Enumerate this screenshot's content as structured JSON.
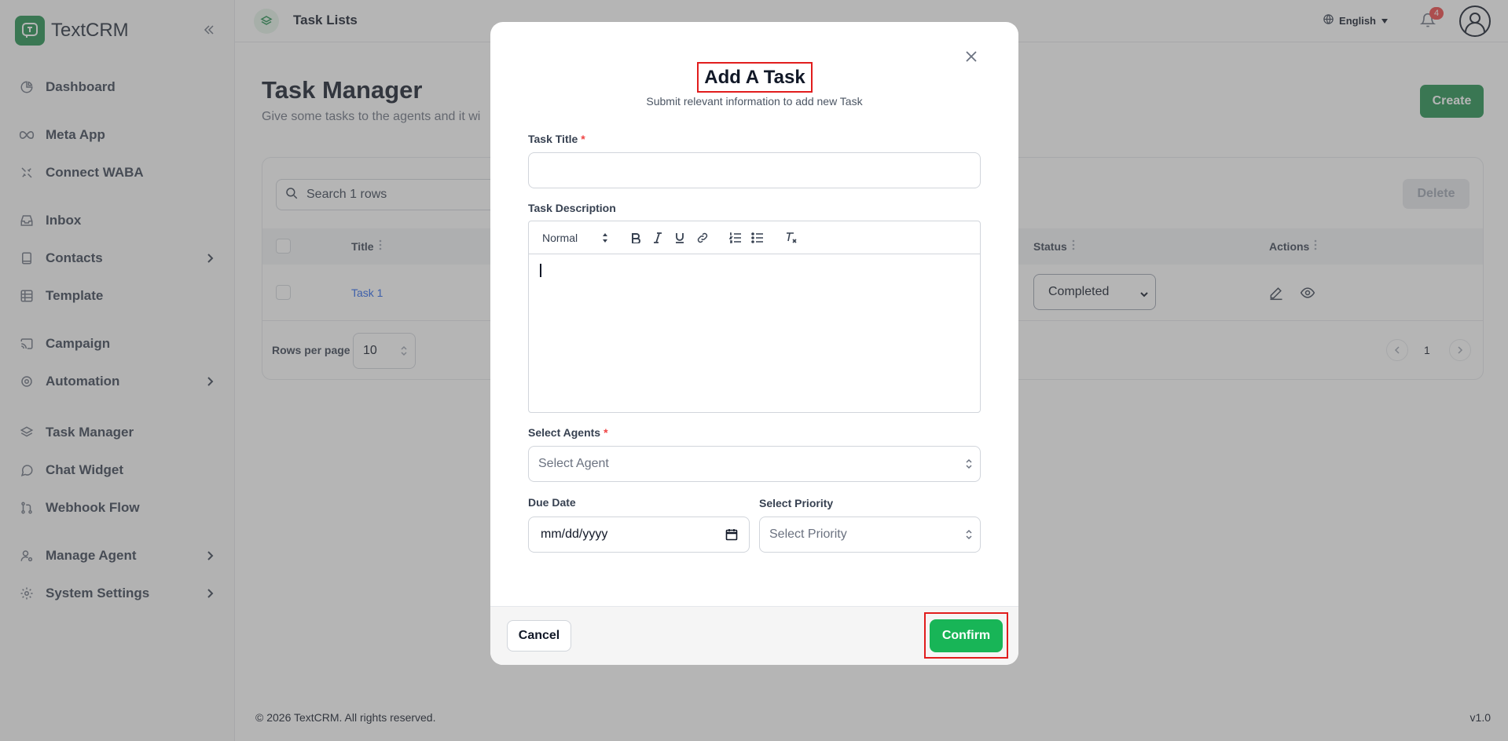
{
  "app": {
    "name": "TextCRM"
  },
  "sidebar": {
    "items": [
      {
        "label": "Dashboard",
        "icon": "chart-pie-icon"
      },
      {
        "label": "Meta App",
        "icon": "meta-infinity-icon"
      },
      {
        "label": "Connect WABA",
        "icon": "plug-icon"
      },
      {
        "label": "Inbox",
        "icon": "inbox-icon"
      },
      {
        "label": "Contacts",
        "icon": "book-icon",
        "has_submenu": true
      },
      {
        "label": "Template",
        "icon": "table-icon"
      },
      {
        "label": "Campaign",
        "icon": "cast-icon"
      },
      {
        "label": "Automation",
        "icon": "gear-icon",
        "has_submenu": true
      },
      {
        "label": "Task Manager",
        "icon": "layers-icon"
      },
      {
        "label": "Chat Widget",
        "icon": "chat-bubble-icon"
      },
      {
        "label": "Webhook Flow",
        "icon": "git-branch-icon"
      },
      {
        "label": "Manage Agent",
        "icon": "user-cog-icon",
        "has_submenu": true
      },
      {
        "label": "System Settings",
        "icon": "settings-icon",
        "has_submenu": true
      }
    ]
  },
  "topbar": {
    "title": "Task Lists",
    "language": "English",
    "notification_count": "4"
  },
  "main": {
    "title": "Task Manager",
    "subtitle": "Give some tasks to the agents and it wi",
    "create_label": "Create",
    "search_placeholder": "Search 1 rows",
    "delete_label": "Delete",
    "columns": {
      "title": "Title",
      "status": "Status",
      "actions": "Actions"
    },
    "rows": [
      {
        "title": "Task 1",
        "status": "Completed"
      }
    ],
    "rows_per_page_label": "Rows per page",
    "rows_per_page_value": "10",
    "current_page": "1"
  },
  "footer": {
    "copyright": "© 2026 TextCRM. All rights reserved.",
    "version": "v1.0"
  },
  "modal": {
    "title": "Add A Task",
    "subtitle": "Submit relevant information to add new Task",
    "task_title_label": "Task Title",
    "task_title_value": "",
    "description_label": "Task Description",
    "editor_format": "Normal",
    "agents_label": "Select Agents",
    "agents_placeholder": "Select Agent",
    "due_date_label": "Due Date",
    "due_date_placeholder": "mm/dd/yyyy",
    "priority_label": "Select Priority",
    "priority_placeholder": "Select Priority",
    "required_mark": "*",
    "cancel_label": "Cancel",
    "confirm_label": "Confirm"
  },
  "colors": {
    "brand": "#1f8f4e",
    "confirm": "#18b557",
    "highlight": "#e11d1d",
    "link": "#2563eb"
  }
}
